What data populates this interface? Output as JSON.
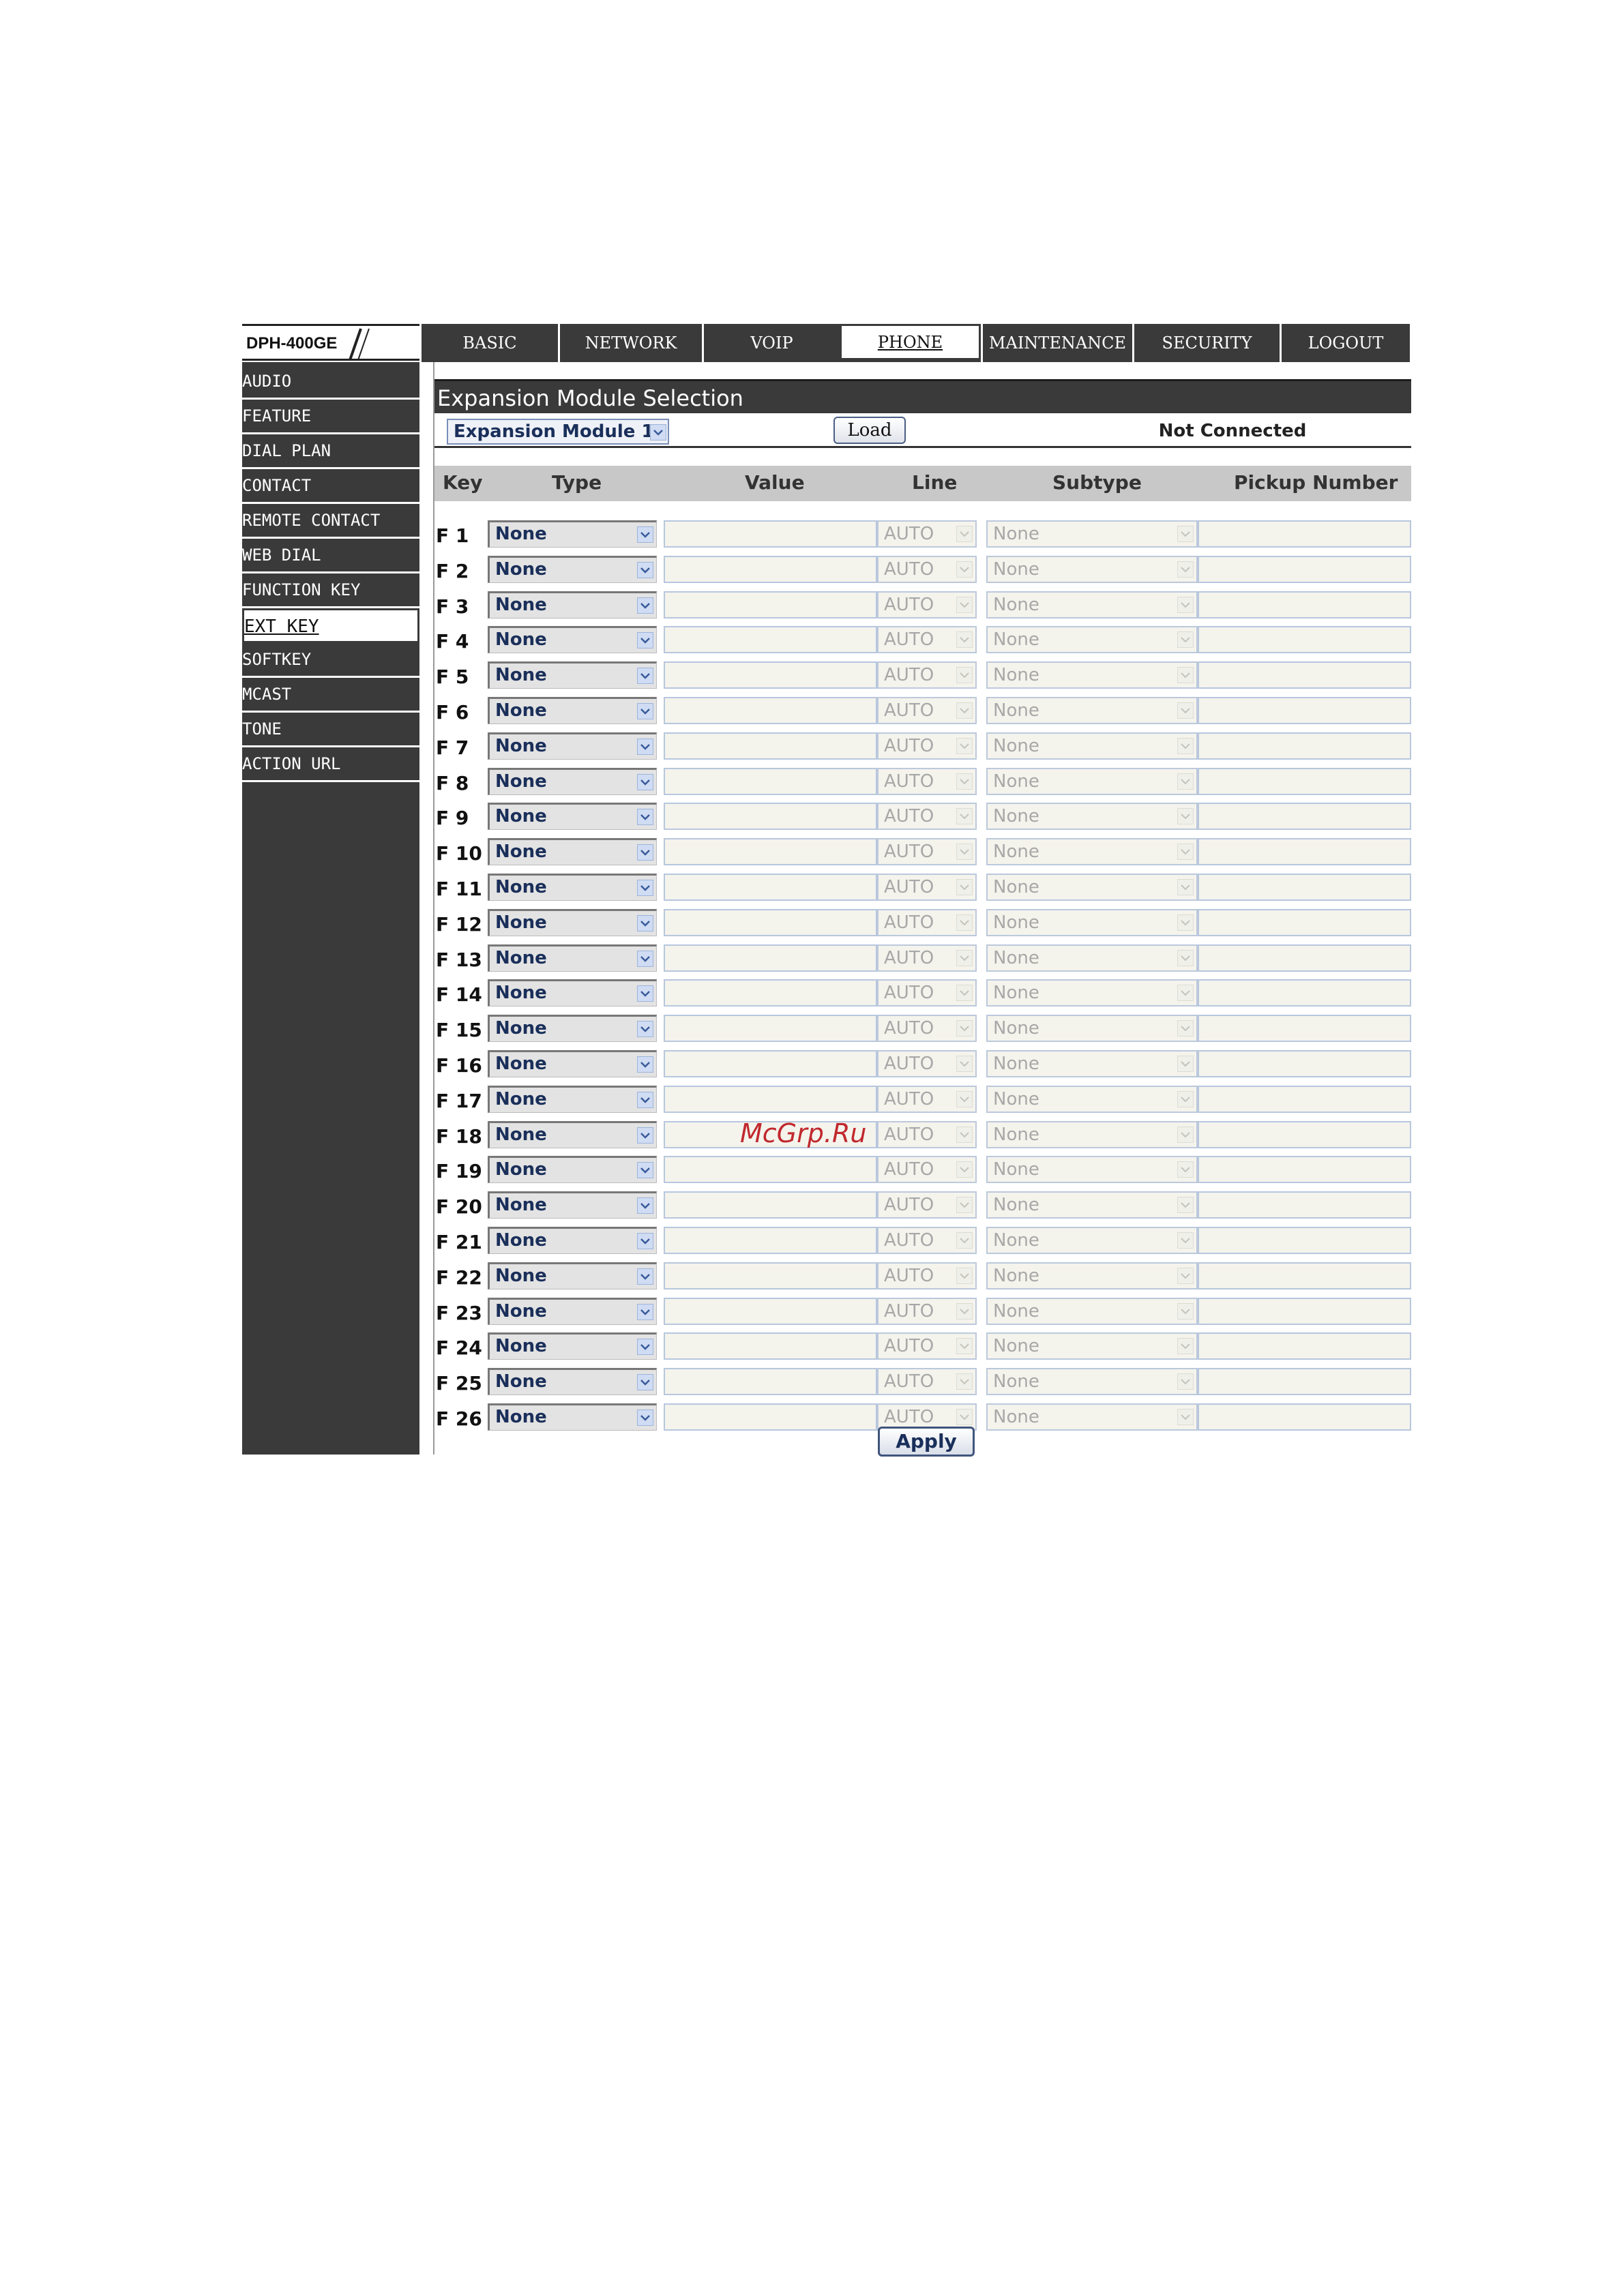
{
  "header": {
    "logo": "DPH-400GE",
    "tabs": [
      {
        "label": "BASIC",
        "active": false
      },
      {
        "label": "NETWORK",
        "active": false
      },
      {
        "label": "VOIP",
        "active": false
      },
      {
        "label": "PHONE",
        "active": true
      },
      {
        "label": "MAINTENANCE",
        "active": false
      },
      {
        "label": "SECURITY",
        "active": false
      },
      {
        "label": "LOGOUT",
        "active": false
      }
    ]
  },
  "sidebar": {
    "items": [
      {
        "label": "AUDIO",
        "active": false
      },
      {
        "label": "FEATURE",
        "active": false
      },
      {
        "label": "DIAL PLAN",
        "active": false
      },
      {
        "label": "CONTACT",
        "active": false
      },
      {
        "label": "REMOTE CONTACT",
        "active": false
      },
      {
        "label": "WEB DIAL",
        "active": false
      },
      {
        "label": "FUNCTION KEY",
        "active": false
      },
      {
        "label": "EXT KEY",
        "active": true
      },
      {
        "label": "SOFTKEY",
        "active": false
      },
      {
        "label": "MCAST",
        "active": false
      },
      {
        "label": "TONE",
        "active": false
      },
      {
        "label": "ACTION URL",
        "active": false
      }
    ]
  },
  "main": {
    "section_title": "Expansion Module Selection",
    "module_select_value": "Expansion Module 1",
    "load_label": "Load",
    "status": "Not Connected",
    "table": {
      "headers": {
        "key": "Key",
        "type": "Type",
        "value": "Value",
        "line": "Line",
        "subtype": "Subtype",
        "pickup": "Pickup Number"
      },
      "rows": [
        {
          "key": "F 1",
          "type": "None",
          "value": "",
          "line": "AUTO",
          "subtype": "None",
          "pickup": ""
        },
        {
          "key": "F 2",
          "type": "None",
          "value": "",
          "line": "AUTO",
          "subtype": "None",
          "pickup": ""
        },
        {
          "key": "F 3",
          "type": "None",
          "value": "",
          "line": "AUTO",
          "subtype": "None",
          "pickup": ""
        },
        {
          "key": "F 4",
          "type": "None",
          "value": "",
          "line": "AUTO",
          "subtype": "None",
          "pickup": ""
        },
        {
          "key": "F 5",
          "type": "None",
          "value": "",
          "line": "AUTO",
          "subtype": "None",
          "pickup": ""
        },
        {
          "key": "F 6",
          "type": "None",
          "value": "",
          "line": "AUTO",
          "subtype": "None",
          "pickup": ""
        },
        {
          "key": "F 7",
          "type": "None",
          "value": "",
          "line": "AUTO",
          "subtype": "None",
          "pickup": ""
        },
        {
          "key": "F 8",
          "type": "None",
          "value": "",
          "line": "AUTO",
          "subtype": "None",
          "pickup": ""
        },
        {
          "key": "F 9",
          "type": "None",
          "value": "",
          "line": "AUTO",
          "subtype": "None",
          "pickup": ""
        },
        {
          "key": "F 10",
          "type": "None",
          "value": "",
          "line": "AUTO",
          "subtype": "None",
          "pickup": ""
        },
        {
          "key": "F 11",
          "type": "None",
          "value": "",
          "line": "AUTO",
          "subtype": "None",
          "pickup": ""
        },
        {
          "key": "F 12",
          "type": "None",
          "value": "",
          "line": "AUTO",
          "subtype": "None",
          "pickup": ""
        },
        {
          "key": "F 13",
          "type": "None",
          "value": "",
          "line": "AUTO",
          "subtype": "None",
          "pickup": ""
        },
        {
          "key": "F 14",
          "type": "None",
          "value": "",
          "line": "AUTO",
          "subtype": "None",
          "pickup": ""
        },
        {
          "key": "F 15",
          "type": "None",
          "value": "",
          "line": "AUTO",
          "subtype": "None",
          "pickup": ""
        },
        {
          "key": "F 16",
          "type": "None",
          "value": "",
          "line": "AUTO",
          "subtype": "None",
          "pickup": ""
        },
        {
          "key": "F 17",
          "type": "None",
          "value": "",
          "line": "AUTO",
          "subtype": "None",
          "pickup": ""
        },
        {
          "key": "F 18",
          "type": "None",
          "value": "",
          "line": "AUTO",
          "subtype": "None",
          "pickup": ""
        },
        {
          "key": "F 19",
          "type": "None",
          "value": "",
          "line": "AUTO",
          "subtype": "None",
          "pickup": ""
        },
        {
          "key": "F 20",
          "type": "None",
          "value": "",
          "line": "AUTO",
          "subtype": "None",
          "pickup": ""
        },
        {
          "key": "F 21",
          "type": "None",
          "value": "",
          "line": "AUTO",
          "subtype": "None",
          "pickup": ""
        },
        {
          "key": "F 22",
          "type": "None",
          "value": "",
          "line": "AUTO",
          "subtype": "None",
          "pickup": ""
        },
        {
          "key": "F 23",
          "type": "None",
          "value": "",
          "line": "AUTO",
          "subtype": "None",
          "pickup": ""
        },
        {
          "key": "F 24",
          "type": "None",
          "value": "",
          "line": "AUTO",
          "subtype": "None",
          "pickup": ""
        },
        {
          "key": "F 25",
          "type": "None",
          "value": "",
          "line": "AUTO",
          "subtype": "None",
          "pickup": ""
        },
        {
          "key": "F 26",
          "type": "None",
          "value": "",
          "line": "AUTO",
          "subtype": "None",
          "pickup": ""
        }
      ]
    },
    "apply_label": "Apply"
  },
  "watermark": "McGrp.Ru",
  "colors": {
    "nav_bg": "#3a3a3a",
    "header_row_bg": "#c8c8c8",
    "select_text": "#1a2f5a",
    "disabled_text": "#a8a8a8",
    "watermark": "#c0282d"
  }
}
